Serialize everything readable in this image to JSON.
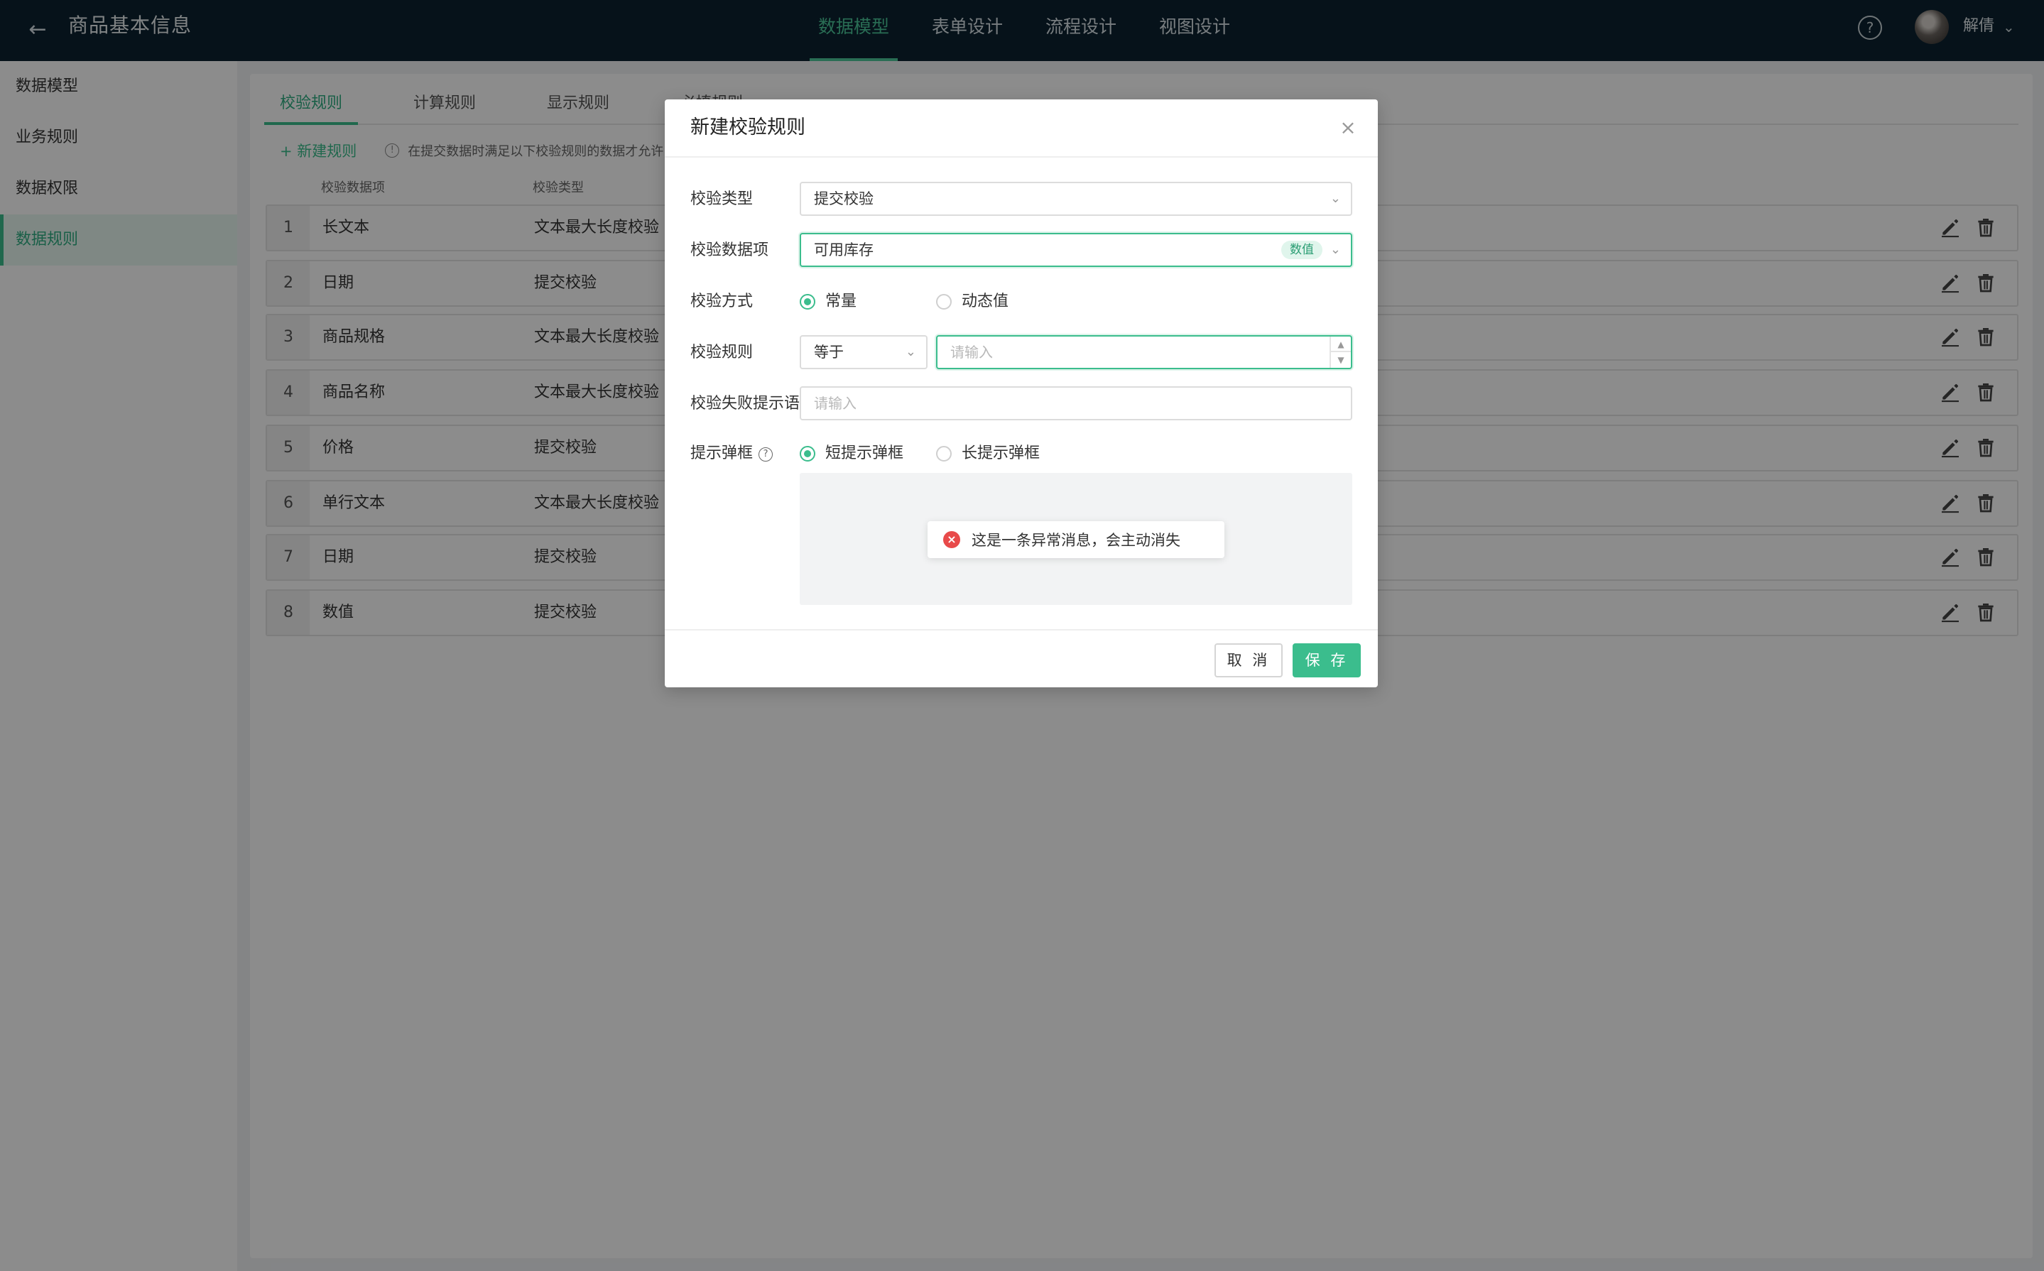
{
  "header": {
    "title": "商品基本信息",
    "nav": [
      "数据模型",
      "表单设计",
      "流程设计",
      "视图设计"
    ],
    "active_nav": 0,
    "help": "?",
    "user_name": "解倩"
  },
  "sidebar": {
    "items": [
      {
        "label": "数据模型"
      },
      {
        "label": "业务规则"
      },
      {
        "label": "数据权限"
      },
      {
        "label": "数据规则"
      }
    ],
    "active": 3
  },
  "main": {
    "tabs": [
      "校验规则",
      "计算规则",
      "显示规则",
      "必填规则"
    ],
    "new_rule": "+ 新建规则",
    "hint": "在提交数据时满足以下校验规则的数据才允许",
    "columns": [
      "校验数据项",
      "校验类型"
    ],
    "rows": [
      {
        "num": "1",
        "field": "长文本",
        "type": "文本最大长度校验"
      },
      {
        "num": "2",
        "field": "日期",
        "type": "提交校验"
      },
      {
        "num": "3",
        "field": "商品规格",
        "type": "文本最大长度校验"
      },
      {
        "num": "4",
        "field": "商品名称",
        "type": "文本最大长度校验"
      },
      {
        "num": "5",
        "field": "价格",
        "type": "提交校验"
      },
      {
        "num": "6",
        "field": "单行文本",
        "type": "文本最大长度校验"
      },
      {
        "num": "7",
        "field": "日期",
        "type": "提交校验"
      },
      {
        "num": "8",
        "field": "数值",
        "type": "提交校验"
      }
    ]
  },
  "modal": {
    "title": "新建校验规则",
    "close": "×",
    "fields": {
      "check_type": {
        "label": "校验类型",
        "value": "提交校验"
      },
      "check_item": {
        "label": "校验数据项",
        "value": "可用库存",
        "tag": "数值"
      },
      "check_method": {
        "label": "校验方式",
        "options": [
          "常量",
          "动态值"
        ],
        "selected": 0
      },
      "check_rule": {
        "label": "校验规则",
        "operator": "等于",
        "placeholder": "请输入"
      },
      "fail_message": {
        "label": "校验失败提示语",
        "placeholder": "请输入"
      },
      "popup": {
        "label": "提示弹框",
        "options": [
          "短提示弹框",
          "长提示弹框"
        ],
        "selected": 0
      }
    },
    "preview_toast": "这是一条异常消息，会主动消失",
    "buttons": {
      "cancel": "取 消",
      "save": "保 存"
    }
  },
  "colors": {
    "accent": "#3bbd8d",
    "topbar": "#0b2230",
    "error": "#e84a4a"
  }
}
